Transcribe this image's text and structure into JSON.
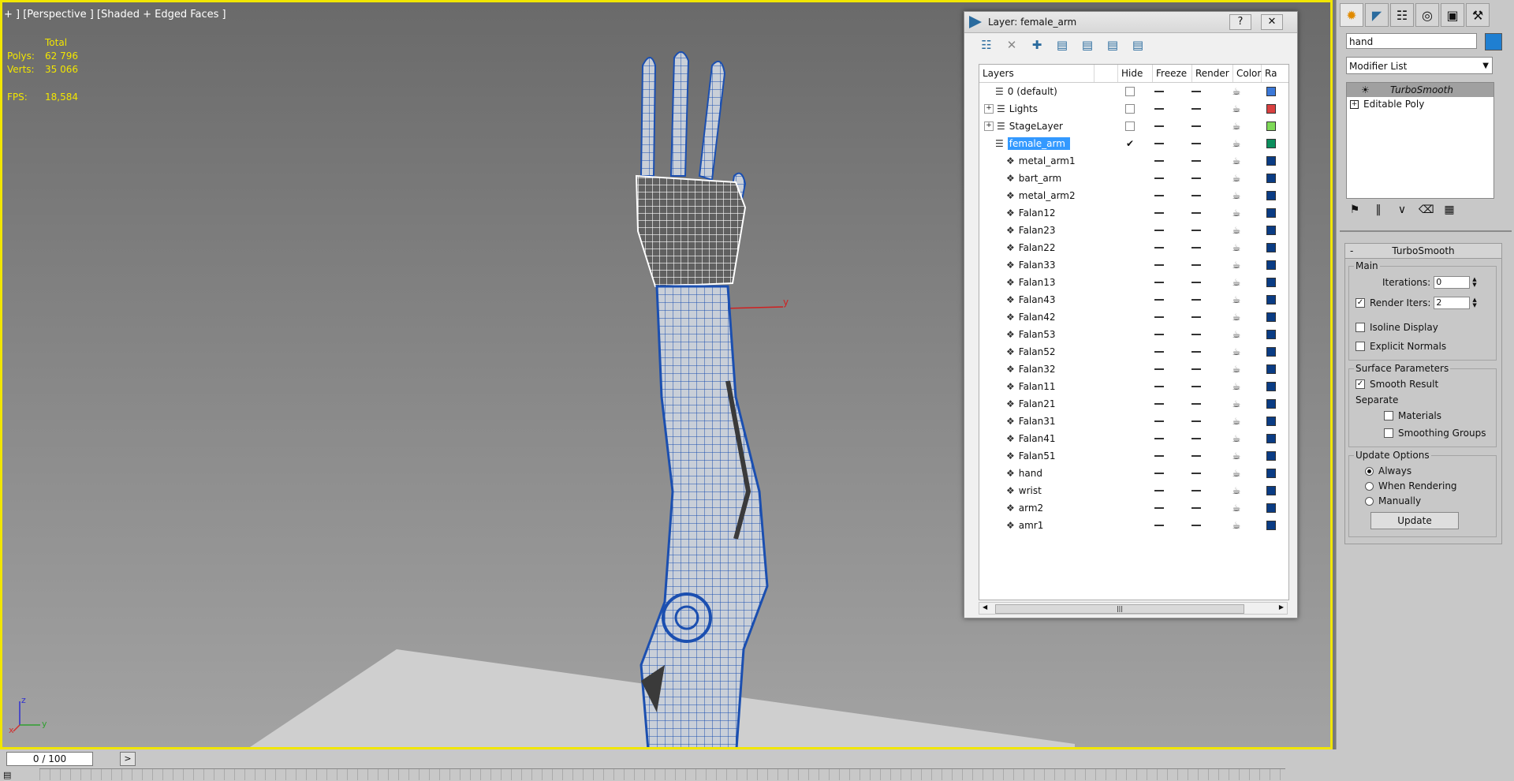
{
  "viewport": {
    "label": "+ ] [Perspective ] [Shaded + Edged Faces ]",
    "stats": {
      "total_label": "Total",
      "polys_label": "Polys:",
      "polys_value": "62 796",
      "verts_label": "Verts:",
      "verts_value": "35 066",
      "fps_label": "FPS:",
      "fps_value": "18,584"
    },
    "gizmo_label": "y",
    "axis": {
      "z": "z",
      "x": "x",
      "y": "y"
    }
  },
  "layer_dialog": {
    "title": "Layer: female_arm",
    "help_label": "?",
    "close_label": "✕",
    "columns": {
      "layers": "Layers",
      "hide": "Hide",
      "freeze": "Freeze",
      "render": "Render",
      "color": "Color",
      "radiosity": "Ra"
    },
    "layers": [
      {
        "name": "0 (default)",
        "kind": "layer",
        "expandable": false,
        "color": "#3b78d8"
      },
      {
        "name": "Lights",
        "kind": "layer",
        "expandable": true,
        "color": "#d94040"
      },
      {
        "name": "StageLayer",
        "kind": "layer",
        "expandable": true,
        "color": "#7ed957"
      },
      {
        "name": "female_arm",
        "kind": "layer",
        "expandable": false,
        "current": true,
        "selected": true,
        "color": "#0c8f5e"
      }
    ],
    "objects": [
      "metal_arm1",
      "bart_arm",
      "metal_arm2",
      "Falan12",
      "Falan23",
      "Falan22",
      "Falan33",
      "Falan13",
      "Falan43",
      "Falan42",
      "Falan53",
      "Falan52",
      "Falan32",
      "Falan11",
      "Falan21",
      "Falan31",
      "Falan41",
      "Falan51",
      "hand",
      "wrist",
      "arm2",
      "amr1"
    ],
    "object_color": "#0a3c84",
    "scroll_grip": "|||"
  },
  "command_panel": {
    "object_name": "hand",
    "object_color": "#1f7fd1",
    "modifier_list": "Modifier List",
    "stack": {
      "active": "TurboSmooth",
      "base": "Editable Poly"
    },
    "turbosmooth": {
      "title": "TurboSmooth",
      "collapse": "-",
      "main_group": "Main",
      "iterations_label": "Iterations:",
      "iterations_value": "0",
      "render_iters_label": "Render Iters:",
      "render_iters_value": "2",
      "isoline_label": "Isoline Display",
      "explicit_normals_label": "Explicit Normals",
      "surface_group": "Surface Parameters",
      "smooth_result_label": "Smooth Result",
      "separate_label": "Separate",
      "materials_label": "Materials",
      "smoothing_groups_label": "Smoothing Groups",
      "update_group": "Update Options",
      "always_label": "Always",
      "when_rendering_label": "When Rendering",
      "manually_label": "Manually",
      "update_button": "Update"
    }
  },
  "timeline": {
    "frame_display": "0 / 100",
    "next_label": ">"
  }
}
